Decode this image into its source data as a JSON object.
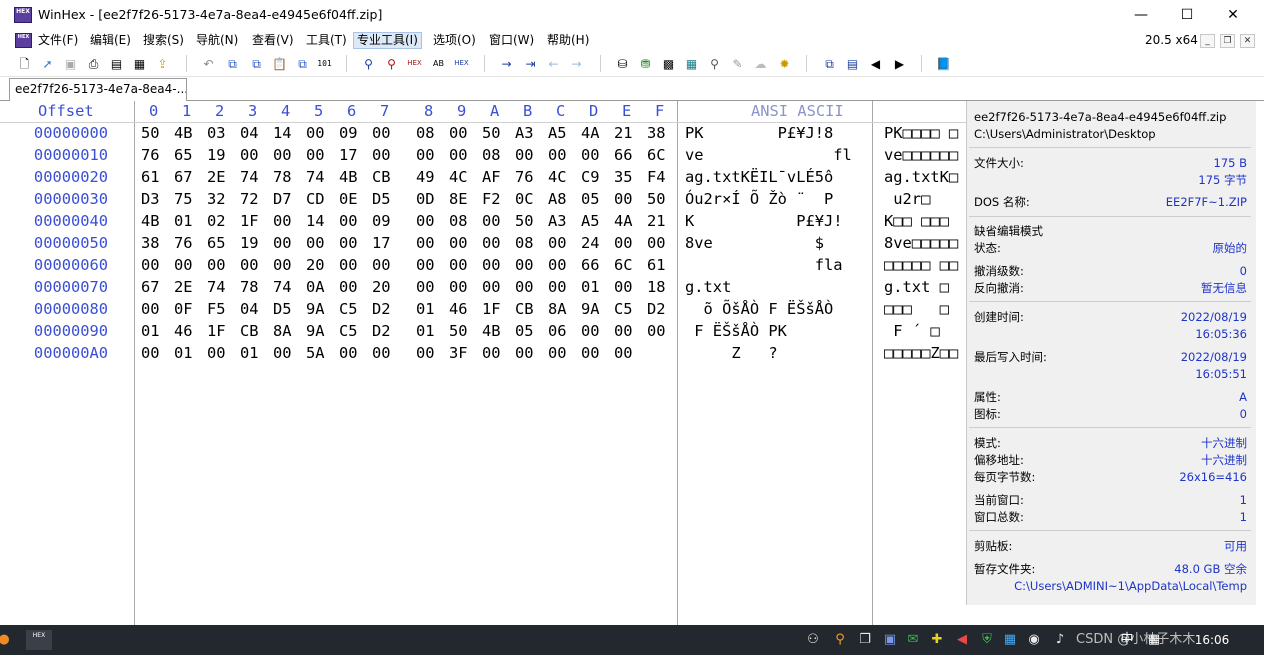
{
  "window": {
    "title": "WinHex - [ee2f7f26-5173-4e7a-8ea4-e4945e6f04ff.zip]",
    "app_icon": "HEX",
    "controls": [
      "minimize-icon",
      "maximize-icon",
      "close-icon"
    ]
  },
  "menubar": {
    "items": [
      "文件(F)",
      "编辑(E)",
      "搜索(S)",
      "导航(N)",
      "查看(V)",
      "工具(T)",
      "专业工具(I)",
      "选项(O)",
      "窗口(W)",
      "帮助(H)"
    ],
    "active_index": 6,
    "zoom": "20.5 x64"
  },
  "toolbar": {
    "icons": [
      "new-file-icon",
      "open-icon",
      "save-icon",
      "print-icon",
      "properties-icon",
      "export-icon",
      "undo-icon",
      "copy-icon",
      "copy-block-icon",
      "paste-icon",
      "clipboard-icon",
      "binary-icon",
      "find-text-icon",
      "find-hex-icon",
      "replace-text-icon",
      "replace-hex-icon",
      "goto-offset-icon",
      "goto-sector-icon",
      "back-icon",
      "forward-icon",
      "disk-icon",
      "ram-icon",
      "image-icon",
      "calculator-icon",
      "search-icon",
      "bookmark-icon",
      "cloud-icon",
      "hash-icon",
      "view-icon",
      "template-icon",
      "prev-icon",
      "next-icon",
      "book-icon"
    ]
  },
  "tab": {
    "label": "ee2f7f26-5173-4e7a-8ea4-..."
  },
  "editor": {
    "offset_header": "Offset",
    "columns": [
      "0",
      "1",
      "2",
      "3",
      "4",
      "5",
      "6",
      "7",
      "8",
      "9",
      "A",
      "B",
      "C",
      "D",
      "E",
      "F"
    ],
    "ansi_header": "ANSI ASCII",
    "rows": [
      {
        "offset": "00000000",
        "bytes": [
          "50",
          "4B",
          "03",
          "04",
          "14",
          "00",
          "09",
          "00",
          "08",
          "00",
          "50",
          "A3",
          "A5",
          "4A",
          "21",
          "38"
        ],
        "ansi": "PK        P£¥J!8",
        "cjk": "PK□□□□ □"
      },
      {
        "offset": "00000010",
        "bytes": [
          "76",
          "65",
          "19",
          "00",
          "00",
          "00",
          "17",
          "00",
          "00",
          "00",
          "08",
          "00",
          "00",
          "00",
          "66",
          "6C"
        ],
        "ansi": "ve              fl",
        "cjk": "ve□□□□□□"
      },
      {
        "offset": "00000020",
        "bytes": [
          "61",
          "67",
          "2E",
          "74",
          "78",
          "74",
          "4B",
          "CB",
          "49",
          "4C",
          "AF",
          "76",
          "4C",
          "C9",
          "35",
          "F4"
        ],
        "ansi": "ag.txtKËIL¯vLÉ5ô",
        "cjk": "ag.txtK□"
      },
      {
        "offset": "00000030",
        "bytes": [
          "D3",
          "75",
          "32",
          "72",
          "D7",
          "CD",
          "0E",
          "D5",
          "0D",
          "8E",
          "F2",
          "0C",
          "A8",
          "05",
          "00",
          "50"
        ],
        "ansi": "Óu2r×Í Õ Žò ¨  P",
        "cjk": " u2r□"
      },
      {
        "offset": "00000040",
        "bytes": [
          "4B",
          "01",
          "02",
          "1F",
          "00",
          "14",
          "00",
          "09",
          "00",
          "08",
          "00",
          "50",
          "A3",
          "A5",
          "4A",
          "21"
        ],
        "ansi": "K           P£¥J!",
        "cjk": "K□□ □□□"
      },
      {
        "offset": "00000050",
        "bytes": [
          "38",
          "76",
          "65",
          "19",
          "00",
          "00",
          "00",
          "17",
          "00",
          "00",
          "00",
          "08",
          "00",
          "24",
          "00",
          "00"
        ],
        "ansi": "8ve           $",
        "cjk": "8ve□□□□□"
      },
      {
        "offset": "00000060",
        "bytes": [
          "00",
          "00",
          "00",
          "00",
          "00",
          "20",
          "00",
          "00",
          "00",
          "00",
          "00",
          "00",
          "00",
          "66",
          "6C",
          "61"
        ],
        "ansi": "              fla",
        "cjk": "□□□□□ □□"
      },
      {
        "offset": "00000070",
        "bytes": [
          "67",
          "2E",
          "74",
          "78",
          "74",
          "0A",
          "00",
          "20",
          "00",
          "00",
          "00",
          "00",
          "00",
          "01",
          "00",
          "18"
        ],
        "ansi": "g.txt",
        "cjk": "g.txt □"
      },
      {
        "offset": "00000080",
        "bytes": [
          "00",
          "0F",
          "F5",
          "04",
          "D5",
          "9A",
          "C5",
          "D2",
          "01",
          "46",
          "1F",
          "CB",
          "8A",
          "9A",
          "C5",
          "D2"
        ],
        "ansi": "  õ ÕšÅÒ F ËŠšÅÒ",
        "cjk": "□□□   □"
      },
      {
        "offset": "00000090",
        "bytes": [
          "01",
          "46",
          "1F",
          "CB",
          "8A",
          "9A",
          "C5",
          "D2",
          "01",
          "50",
          "4B",
          "05",
          "06",
          "00",
          "00",
          "00"
        ],
        "ansi": " F ËŠšÅÒ PK",
        "cjk": " F ´ □"
      },
      {
        "offset": "000000A0",
        "bytes": [
          "00",
          "01",
          "00",
          "01",
          "00",
          "5A",
          "00",
          "00",
          "00",
          "3F",
          "00",
          "00",
          "00",
          "00",
          "00"
        ],
        "ansi": "     Z   ?",
        "cjk": "□□□□□Z□□"
      }
    ]
  },
  "info_panel": {
    "filename": "ee2f7f26-5173-4e7a-8ea4-e4945e6f04ff.zip",
    "path": "C:\\Users\\Administrator\\Desktop",
    "file_size_label": "文件大小:",
    "file_size_bytes": "175 B",
    "file_size_chars": "175 字节",
    "dos_name_label": "DOS 名称:",
    "dos_name": "EE2F7F~1.ZIP",
    "edit_mode_label": "缺省编辑模式",
    "state_label": "状态:",
    "state": "原始的",
    "undo_level_label": "撤消级数:",
    "undo_level": "0",
    "redo_label": "反向撤消:",
    "redo": "暂无信息",
    "created_label": "创建时间:",
    "created_date": "2022/08/19",
    "created_time": "16:05:36",
    "modified_label": "最后写入时间:",
    "modified_date": "2022/08/19",
    "modified_time": "16:05:51",
    "attr_label": "属性:",
    "attr": "A",
    "icon_label": "图标:",
    "icon": "0",
    "mode_label": "模式:",
    "mode": "十六进制",
    "offset_addr_label": "偏移地址:",
    "offset_addr": "十六进制",
    "bytes_per_page_label": "每页字节数:",
    "bytes_per_page": "26x16=416",
    "current_window_label": "当前窗口:",
    "current_window": "1",
    "window_count_label": "窗口总数:",
    "window_count": "1",
    "clipboard_label": "剪贴板:",
    "clipboard": "可用",
    "temp_label": "暂存文件夹:",
    "temp_free": "48.0 GB 空余",
    "temp_path": "C:\\Users\\ADMINI~1\\AppData\\Local\\Temp"
  },
  "taskbar": {
    "app_icon": "HEX",
    "tray_text": "中",
    "clock": "16:06",
    "watermark": "CSDN @小林子木木"
  }
}
